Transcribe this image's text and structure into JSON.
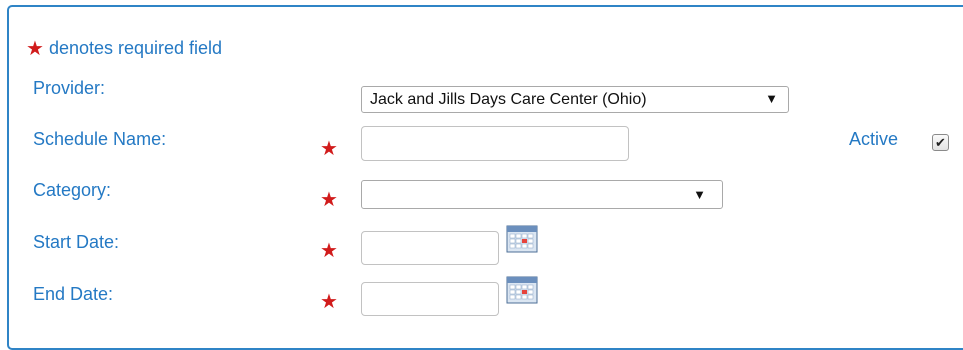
{
  "form": {
    "required_legend": "denotes required field",
    "provider": {
      "label": "Provider:",
      "selected": "Jack and Jills Days Care Center (Ohio)"
    },
    "schedule_name": {
      "label": "Schedule Name:",
      "value": ""
    },
    "active": {
      "label": "Active",
      "checked": true,
      "check_glyph": "✔"
    },
    "category": {
      "label": "Category:",
      "selected": ""
    },
    "start_date": {
      "label": "Start Date:",
      "value": ""
    },
    "end_date": {
      "label": "End Date:",
      "value": ""
    },
    "required_marker": "★",
    "dropdown_arrow": "▼"
  },
  "icons": {
    "required": "star-icon",
    "calendar": "calendar-icon",
    "dropdown": "chevron-down-icon",
    "checkmark": "checkmark-icon"
  },
  "colors": {
    "label_blue": "#2479c4",
    "required_red": "#d11b1b",
    "panel_border": "#2f84c6"
  }
}
